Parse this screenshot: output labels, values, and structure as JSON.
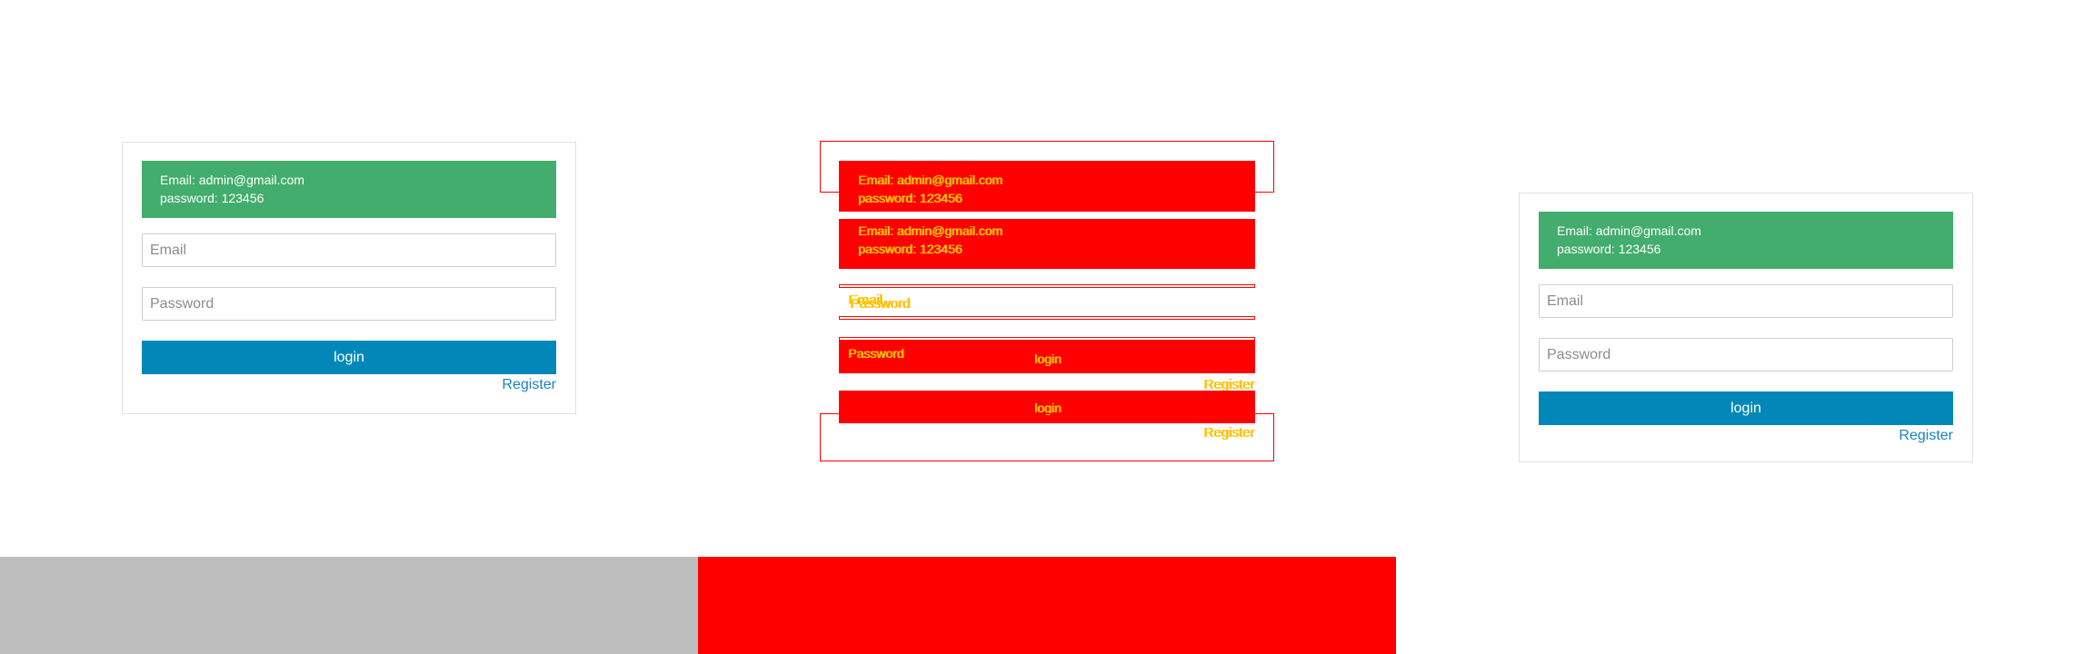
{
  "login_panel": {
    "info_email": "Email: admin@gmail.com",
    "info_password": "password: 123456",
    "email_placeholder": "Email",
    "password_placeholder": "Password",
    "login_label": "login",
    "register_label": "Register"
  },
  "debug_overlay": {
    "info_email": "Email: admin@gmail.com",
    "info_password": "password: 123456",
    "email_label": "Email",
    "password_label": "Password",
    "login_label": "login",
    "register_label": "Register"
  },
  "colors": {
    "alert_green": "#42ad6c",
    "button_blue": "#0288b8",
    "link_blue": "#1a82c4",
    "debug_red": "#ff0000",
    "debug_text_yellow": "#ffd500",
    "bottom_gray": "#bdbdbd"
  }
}
